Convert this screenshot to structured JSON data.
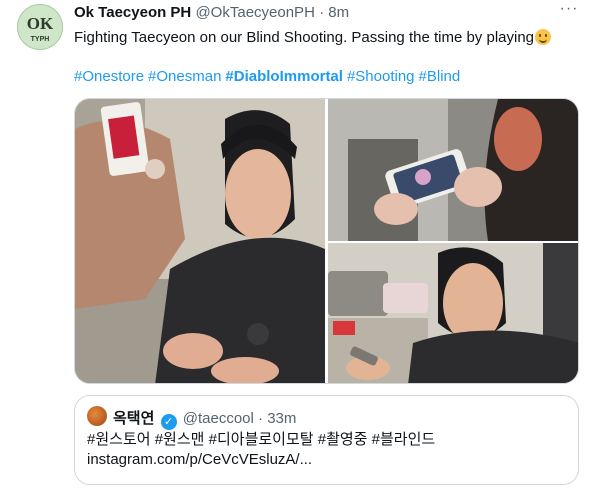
{
  "tweet": {
    "author_name": "Ok Taecyeon PH",
    "author_handle": "@OkTaecyeonPH",
    "separator": " · ",
    "time": "8m",
    "more_icon": "more-horizontal-icon",
    "text": "Fighting Taecyeon on our Blind Shooting. Passing the time by playing",
    "emoji": "smiling-face-emoji",
    "hashtags": [
      {
        "text": "#Onestore",
        "bold": false
      },
      {
        "text": "#Onesman",
        "bold": false
      },
      {
        "text": "#DiabloImmortal",
        "bold": true
      },
      {
        "text": "#Shooting",
        "bold": false
      },
      {
        "text": "#Blind",
        "bold": false
      }
    ],
    "avatar_logo": {
      "letters": "OK",
      "caption": "TYPH"
    }
  },
  "quote": {
    "author_name": "옥택연",
    "author_handle": "@taeccool",
    "separator": " · ",
    "time": "33m",
    "line1": "#원스토어 #원스맨 #디아블로이모탈 #촬영중 #블라인드",
    "line2": "instagram.com/p/CeVcVEsluzA/..."
  },
  "colors": {
    "link": "#1d9bf0",
    "text": "#0f1419",
    "muted": "#536471",
    "border": "#cfd9de"
  }
}
